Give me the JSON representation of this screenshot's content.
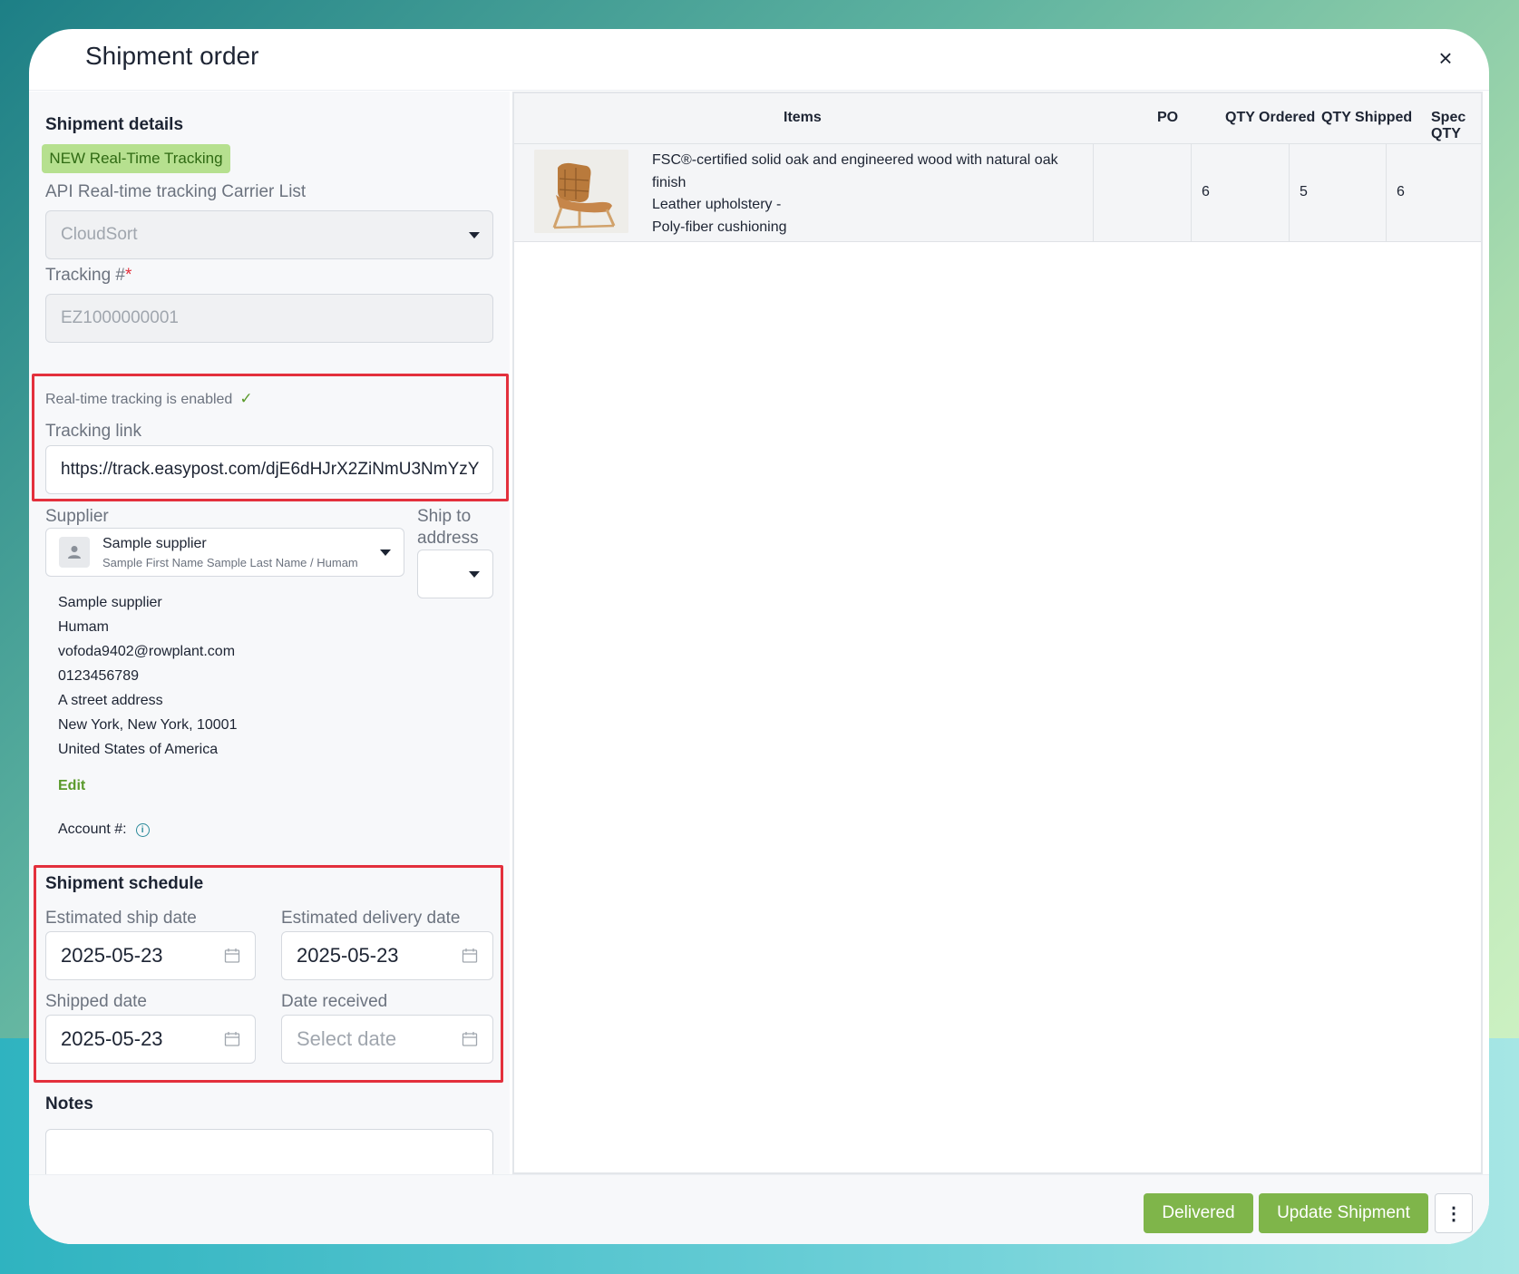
{
  "modal": {
    "title": "Shipment order",
    "close_glyph": "×"
  },
  "details": {
    "section_title": "Shipment details",
    "badge": "NEW Real-Time Tracking",
    "carrier_label": "API Real-time tracking Carrier List",
    "carrier_value": "CloudSort",
    "tracking_label": "Tracking #",
    "required_mark": "*",
    "tracking_value": "EZ1000000001",
    "tracking_enabled_text": "Real-time tracking is enabled",
    "check_glyph": "✓",
    "tracking_link_label": "Tracking link",
    "tracking_link_value": "https://track.easypost.com/djE6dHJrX2ZiNmU3NmYzY"
  },
  "supplier": {
    "label": "Supplier",
    "name": "Sample supplier",
    "subtitle": "Sample First Name Sample Last Name / Humam",
    "ship_to_label_1": "Ship to",
    "ship_to_label_2": "address",
    "address_lines": [
      "Sample supplier",
      "Humam",
      "vofoda9402@rowplant.com",
      "0123456789",
      "A street address",
      "New York, New York, 10001",
      "United States of America"
    ],
    "edit_label": "Edit",
    "account_label": "Account #:",
    "info_glyph": "i"
  },
  "schedule": {
    "section_title": "Shipment schedule",
    "est_ship_label": "Estimated ship date",
    "est_ship_value": "2025-05-23",
    "est_delivery_label": "Estimated delivery date",
    "est_delivery_value": "2025-05-23",
    "shipped_label": "Shipped date",
    "shipped_value": "2025-05-23",
    "received_label": "Date received",
    "received_placeholder": "Select date"
  },
  "notes": {
    "label": "Notes"
  },
  "table": {
    "headers": [
      "Items",
      "PO",
      "QTY Ordered",
      "QTY Shipped",
      "Spec QTY"
    ],
    "rows": [
      {
        "description_lines": [
          "FSC®-certified solid oak and engineered wood with natural oak finish",
          "Leather upholstery -",
          "Poly-fiber cushioning"
        ],
        "po": "",
        "qty_ordered": "6",
        "qty_shipped": "5",
        "spec_qty": "6"
      }
    ]
  },
  "footer": {
    "delivered_label": "Delivered",
    "update_label": "Update Shipment",
    "more_glyph": "⋮"
  },
  "colors": {
    "accent_green": "#7fb54a",
    "badge_bg": "#b6e08f",
    "highlight_red": "#e3303c"
  }
}
